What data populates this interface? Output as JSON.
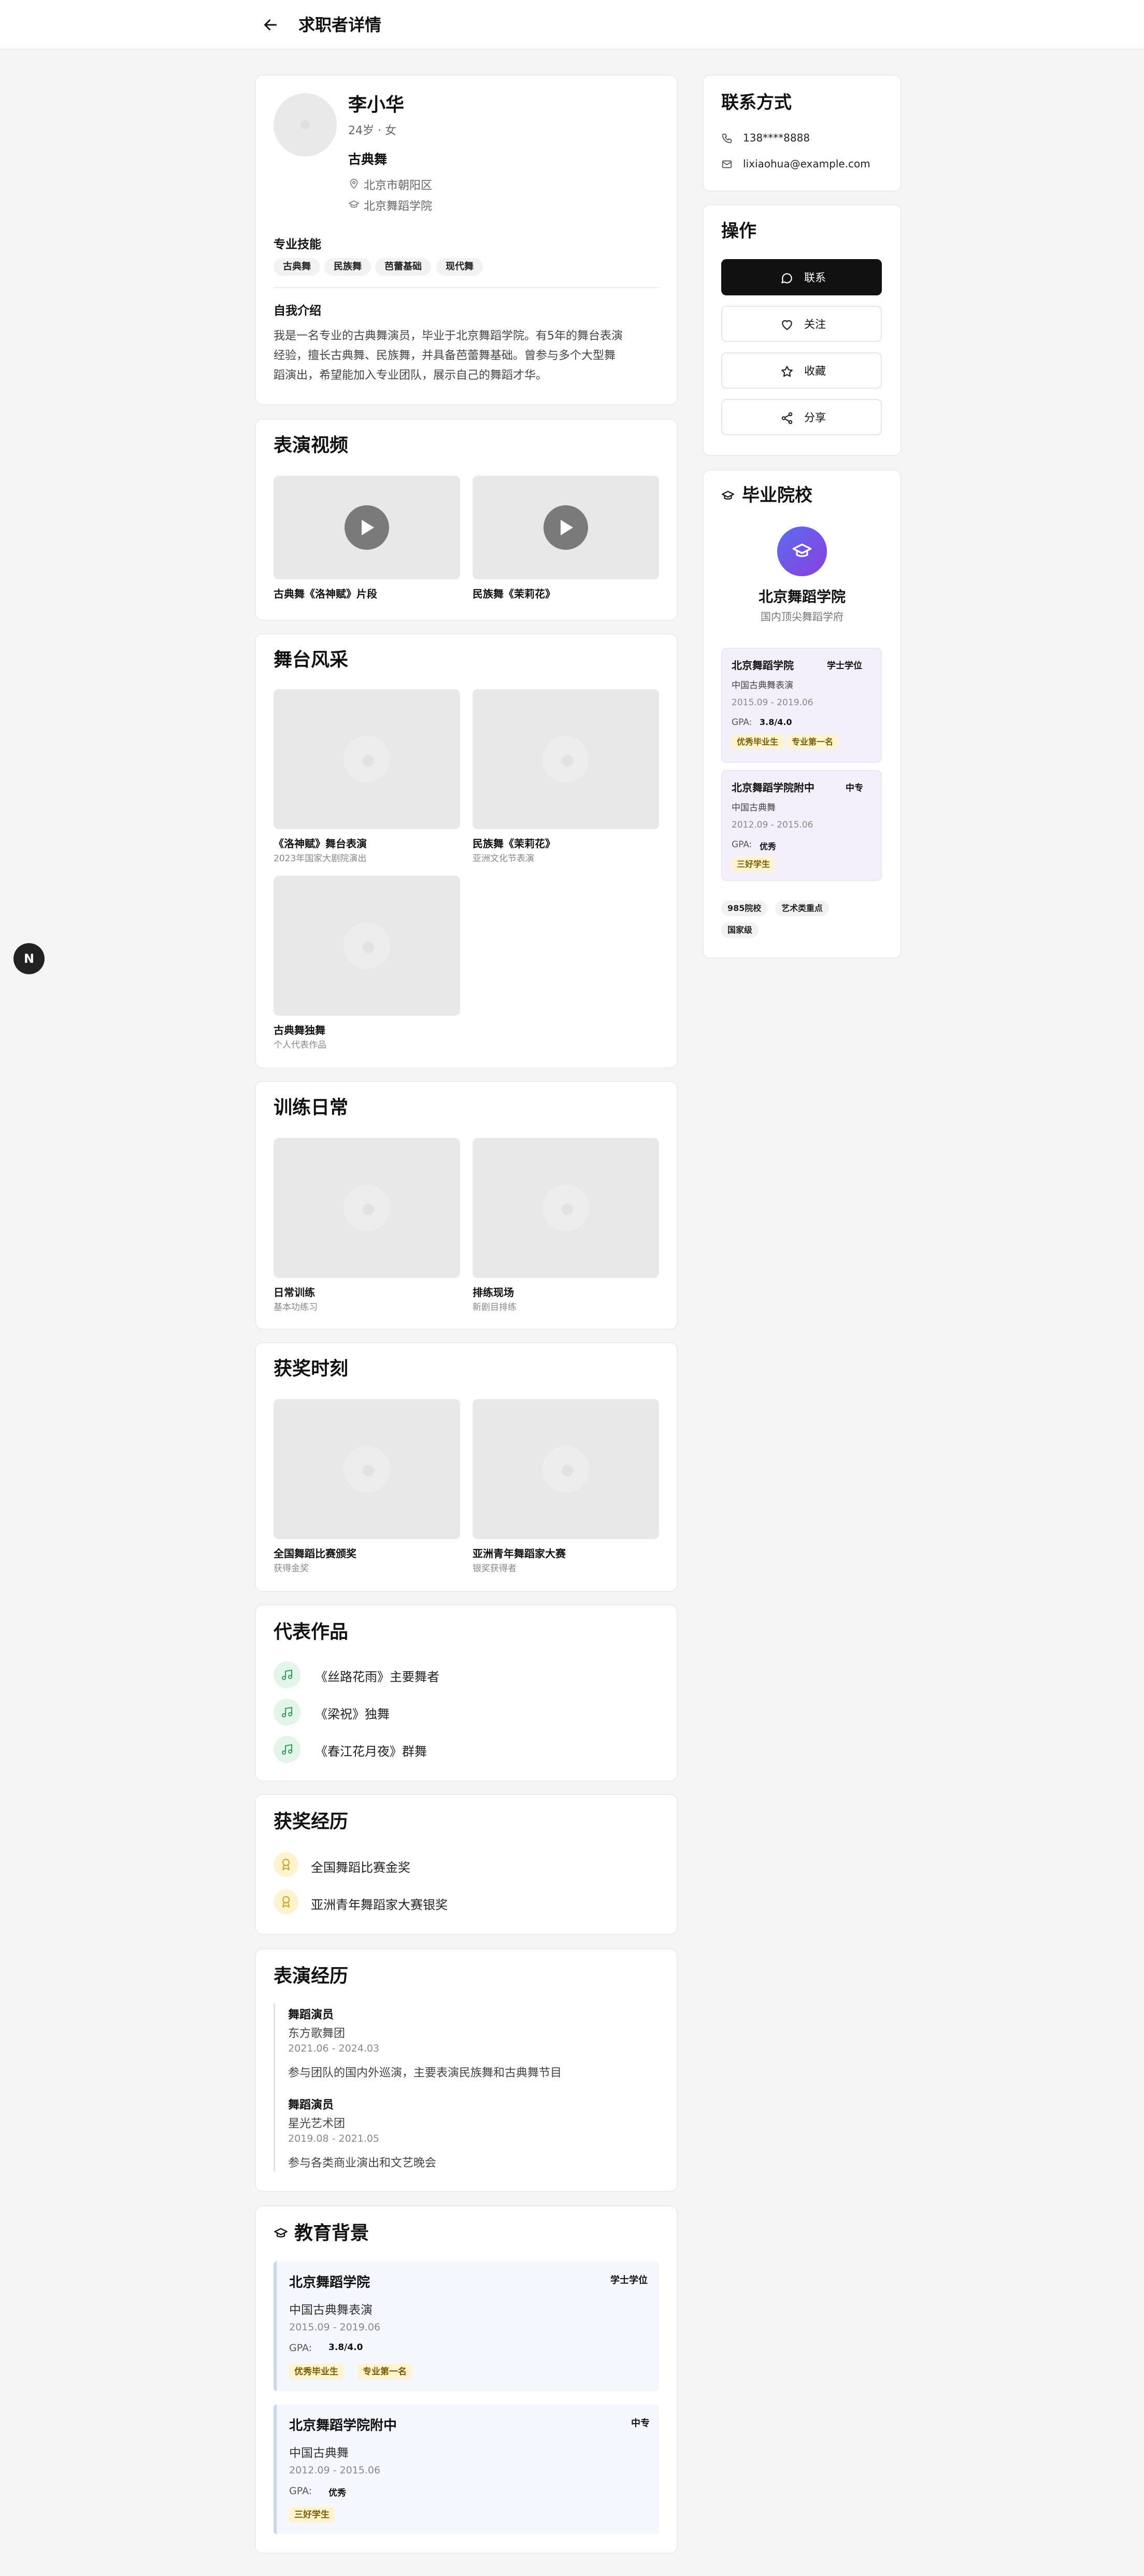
{
  "header": {
    "title": "求职者详情"
  },
  "profile": {
    "name": "李小华",
    "age_gender": "24岁 · 女",
    "dance_type": "古典舞",
    "location": "北京市朝阳区",
    "school": "北京舞蹈学院",
    "skills_title": "专业技能",
    "skills": [
      "古典舞",
      "民族舞",
      "芭蕾基础",
      "现代舞"
    ],
    "intro_title": "自我介绍",
    "intro_lines": [
      "我是一名专业的古典舞演员，毕业于北京舞蹈学院。有5年的舞台表演",
      "经验，擅长古典舞、民族舞，并具备芭蕾舞基础。曾参与多个大型舞",
      "蹈演出，希望能加入专业团队，展示自己的舞蹈才华。"
    ]
  },
  "videos": {
    "title": "表演视频",
    "items": [
      {
        "caption": "古典舞《洛神赋》片段"
      },
      {
        "caption": "民族舞《茉莉花》"
      }
    ]
  },
  "stage": {
    "title": "舞台风采",
    "items": [
      {
        "caption": "《洛神赋》舞台表演",
        "sub": "2023年国家大剧院演出"
      },
      {
        "caption": "民族舞《茉莉花》",
        "sub": "亚洲文化节表演"
      },
      {
        "caption": "古典舞独舞",
        "sub": "个人代表作品"
      }
    ]
  },
  "training": {
    "title": "训练日常",
    "items": [
      {
        "caption": "日常训练",
        "sub": "基本功练习"
      },
      {
        "caption": "排练现场",
        "sub": "新剧目排练"
      }
    ]
  },
  "awards_moments": {
    "title": "获奖时刻",
    "items": [
      {
        "caption": "全国舞蹈比赛颁奖",
        "sub": "获得金奖"
      },
      {
        "caption": "亚洲青年舞蹈家大赛",
        "sub": "银奖获得者"
      }
    ]
  },
  "works": {
    "title": "代表作品",
    "items": [
      "《丝路花雨》主要舞者",
      "《梁祝》独舞",
      "《春江花月夜》群舞"
    ]
  },
  "awards": {
    "title": "获奖经历",
    "items": [
      "全国舞蹈比赛金奖",
      "亚洲青年舞蹈家大赛银奖"
    ]
  },
  "experience": {
    "title": "表演经历",
    "items": [
      {
        "role": "舞蹈演员",
        "org": "东方歌舞团",
        "period": "2021.06 - 2024.03",
        "desc": "参与团队的国内外巡演，主要表演民族舞和古典舞节目"
      },
      {
        "role": "舞蹈演员",
        "org": "星光艺术团",
        "period": "2019.08 - 2021.05",
        "desc": "参与各类商业演出和文艺晚会"
      }
    ]
  },
  "education": {
    "title": "教育背景",
    "gpa_label": "GPA:",
    "items": [
      {
        "school": "北京舞蹈学院",
        "degree": "学士学位",
        "major": "中国古典舞表演",
        "period": "2015.09 - 2019.06",
        "gpa": "3.8/4.0",
        "badges": [
          "优秀毕业生",
          "专业第一名"
        ]
      },
      {
        "school": "北京舞蹈学院附中",
        "degree": "中专",
        "major": "中国古典舞",
        "period": "2012.09 - 2015.06",
        "gpa": "优秀",
        "badges": [
          "三好学生"
        ]
      }
    ]
  },
  "contact": {
    "title": "联系方式",
    "phone": "138****8888",
    "email": "lixiaohua@example.com"
  },
  "actions": {
    "title": "操作",
    "contact": "联系",
    "follow": "关注",
    "favorite": "收藏",
    "share": "分享"
  },
  "graduate": {
    "title": "毕业院校",
    "school": "北京舞蹈学院",
    "desc": "国内顶尖舞蹈学府",
    "tags": [
      "985院校",
      "艺术类重点",
      "国家级"
    ]
  },
  "floating": {
    "label": "N"
  },
  "colors": {
    "primary_button": "#111111",
    "gold": "#f3c64b",
    "green": "#2e9d57",
    "purple": "#7b4fe6"
  }
}
